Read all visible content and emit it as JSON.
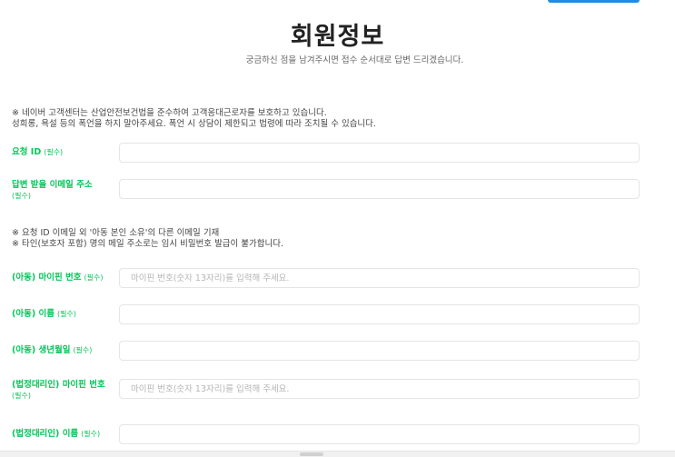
{
  "header": {
    "title": "회원정보",
    "subtitle": "궁금하신 점을 남겨주시면 접수 순서대로 답변 드리겠습니다."
  },
  "notice_top": {
    "line1": "※ 네이버 고객센터는 산업안전보건법을 준수하여 고객응대근로자를 보호하고 있습니다.",
    "line2": "성희롱, 욕설 등의 폭언을 하지 말아주세요. 폭언 시 상담이 제한되고 법령에 따라 조치될 수 있습니다."
  },
  "notice_mid": {
    "line1": "※ 요청 ID 이메일 외 '아동 본인 소유'의 다른 이메일 기재",
    "line2": "※ 타인(보호자 포함) 명의 메일 주소로는 임시 비밀번호 발급이 불가합니다."
  },
  "form": {
    "request_id": {
      "label": "요청 ID",
      "required": "(필수)",
      "value": "",
      "placeholder": ""
    },
    "reply_email": {
      "label": "답변 받을 이메일 주소",
      "required": "(필수)",
      "value": "",
      "placeholder": ""
    },
    "child_ipin": {
      "label": "(아동) 마이핀 번호",
      "required": "(필수)",
      "value": "",
      "placeholder": "마이핀 번호(숫자 13자리)를 입력해 주세요."
    },
    "child_name": {
      "label": "(아동) 이름",
      "required": "(필수)",
      "value": "",
      "placeholder": ""
    },
    "child_birth": {
      "label": "(아동) 생년월일",
      "required": "(필수)",
      "value": "",
      "placeholder": ""
    },
    "guardian_ipin": {
      "label": "(법정대리인) 마이핀 번호",
      "required": "(필수)",
      "value": "",
      "placeholder": "마이핀 번호(숫자 13자리)를 입력해 주세요."
    },
    "guardian_name": {
      "label": "(법정대리인) 이름",
      "required": "(필수)",
      "value": "",
      "placeholder": ""
    }
  },
  "colors": {
    "accent_green": "#03c75a",
    "button_blue": "#1f8ce6",
    "input_border": "#e5e5e5"
  }
}
